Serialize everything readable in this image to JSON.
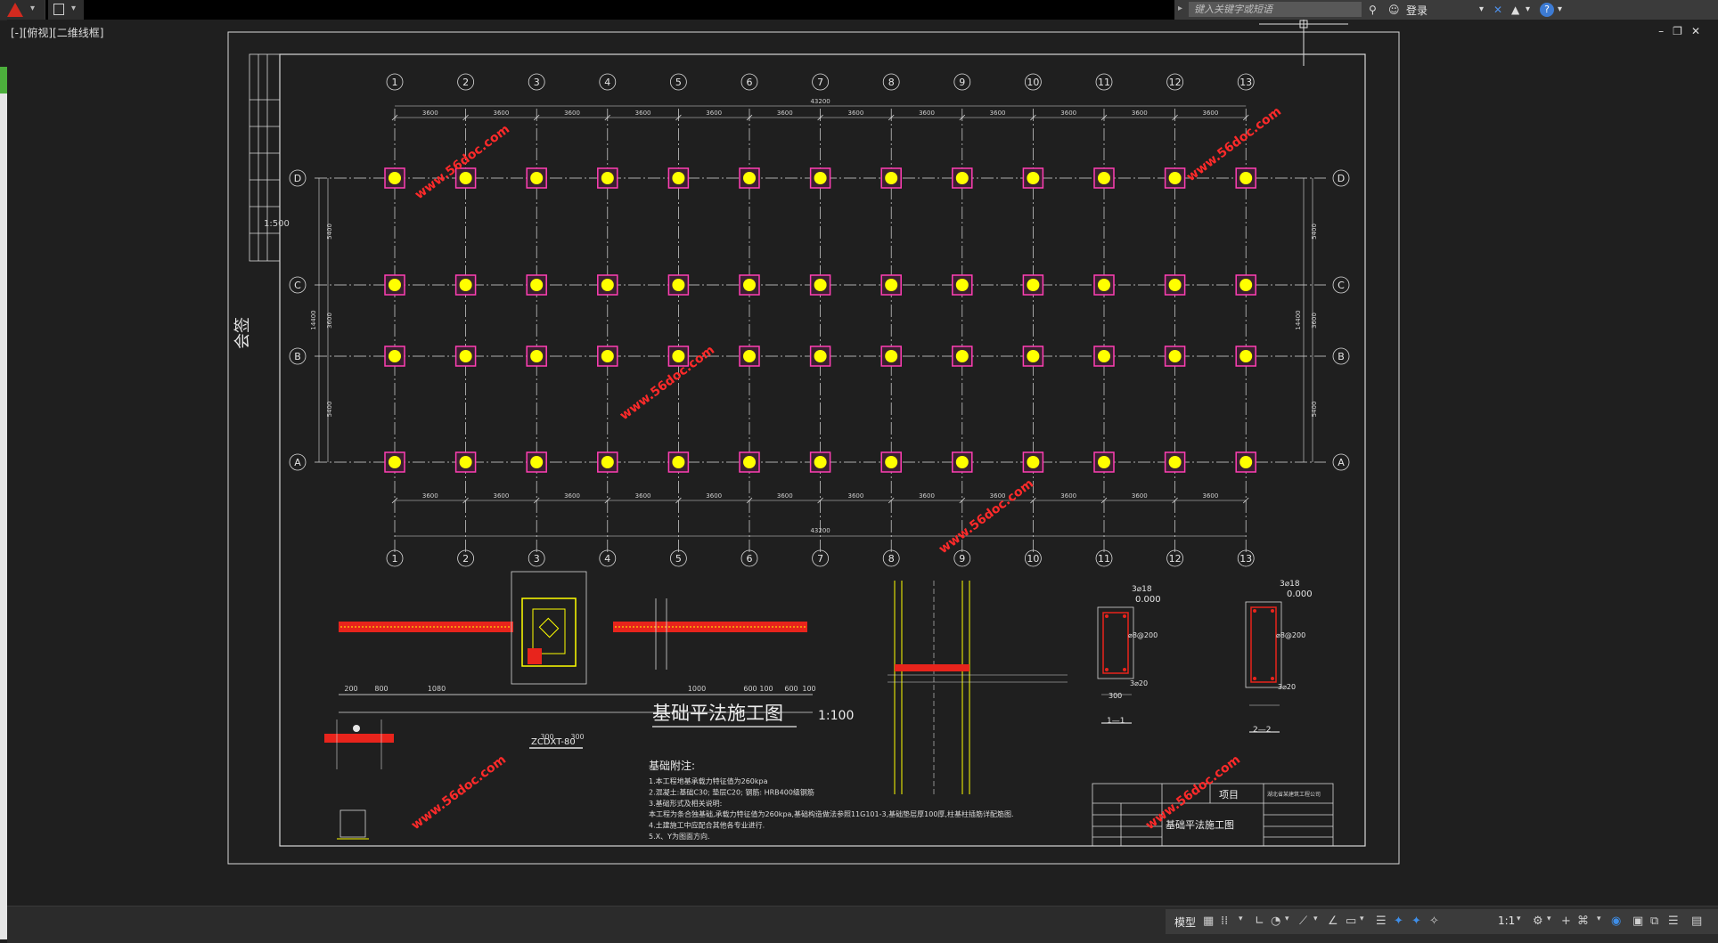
{
  "titlebar": {
    "app_icon": "autocad-logo-icon",
    "search_placeholder": "键入关键字或短语",
    "login_label": "登录",
    "icons": [
      "binoculars-icon",
      "user-icon",
      "x-exchange-icon",
      "a360-icon",
      "help-icon"
    ]
  },
  "viewport": {
    "label": "[-][俯视][二维线框]"
  },
  "window_controls": [
    "minimize-icon",
    "restore-icon",
    "close-icon"
  ],
  "drawing": {
    "grid_numbers": [
      "1",
      "2",
      "3",
      "4",
      "5",
      "6",
      "7",
      "8",
      "9",
      "10",
      "11",
      "12",
      "13"
    ],
    "grid_letters": [
      "A",
      "B",
      "C",
      "D"
    ],
    "bay_dim": "3600",
    "total_length": "43200",
    "side_dims": [
      "5400",
      "3600",
      "5400"
    ],
    "total_width": "14400",
    "main_title": "基础平法施工图",
    "scale": "1:100",
    "sign_label": "会签",
    "sign_scale": "1:500",
    "detail_label": "ZCDXT-80",
    "notes_title": "基础附注:",
    "notes": [
      "1.本工程地基承载力特征值为260kpa",
      "2.混凝土:基础C30; 垫层C20; 钢筋: HRB400级钢筋",
      "3.基础形式及相关说明:",
      "本工程为条合独基础,承载力特征值为260kpa,基础构造做法参照11G101-3,基础垫层厚100厚,柱基柱插筋详配筋图.",
      "4.土建施工中应配合其他各专业进行.",
      "5.X、Y为图面方向."
    ],
    "title_block": {
      "project_label": "项目",
      "drawing_name": "基础平法施工图",
      "company": "湖北省某建筑工程公司"
    },
    "watermark": "www.56doc.com",
    "section_labels": [
      "1—1",
      "2—2"
    ],
    "rebar_labels": {
      "top": "3⌀18",
      "stirrup": "⌀8@200",
      "bottom": "3⌀20",
      "level": "0.000",
      "width": "300"
    },
    "footing_dims": {
      "left": [
        "200",
        "800",
        "1080"
      ],
      "right": [
        "1000",
        "600",
        "100",
        "600",
        "100"
      ],
      "bottom": [
        "300",
        "300"
      ]
    }
  },
  "statusbar": {
    "model_label": "模型",
    "scale_label": "1:1",
    "icons": [
      "grid-icon",
      "snap-icon",
      "ortho-icon",
      "polar-icon",
      "osnap-icon",
      "otrack-icon",
      "lineweight-icon",
      "transparency-icon",
      "selection-cycle-icon",
      "annotation-icon",
      "workspace-icon",
      "plus-icon",
      "isolate-icon",
      "hardware-icon",
      "fullscreen-icon",
      "customize-icon"
    ]
  },
  "colors": {
    "canvas_bg": "#1f1f1f",
    "frame": "#d8d8d8",
    "column_fill": "#ffff00",
    "column_border": "#ff3fb4",
    "rebar_red": "#e8241c",
    "watermark": "#ff2a2a",
    "axis_line": "#dcdcdc"
  }
}
